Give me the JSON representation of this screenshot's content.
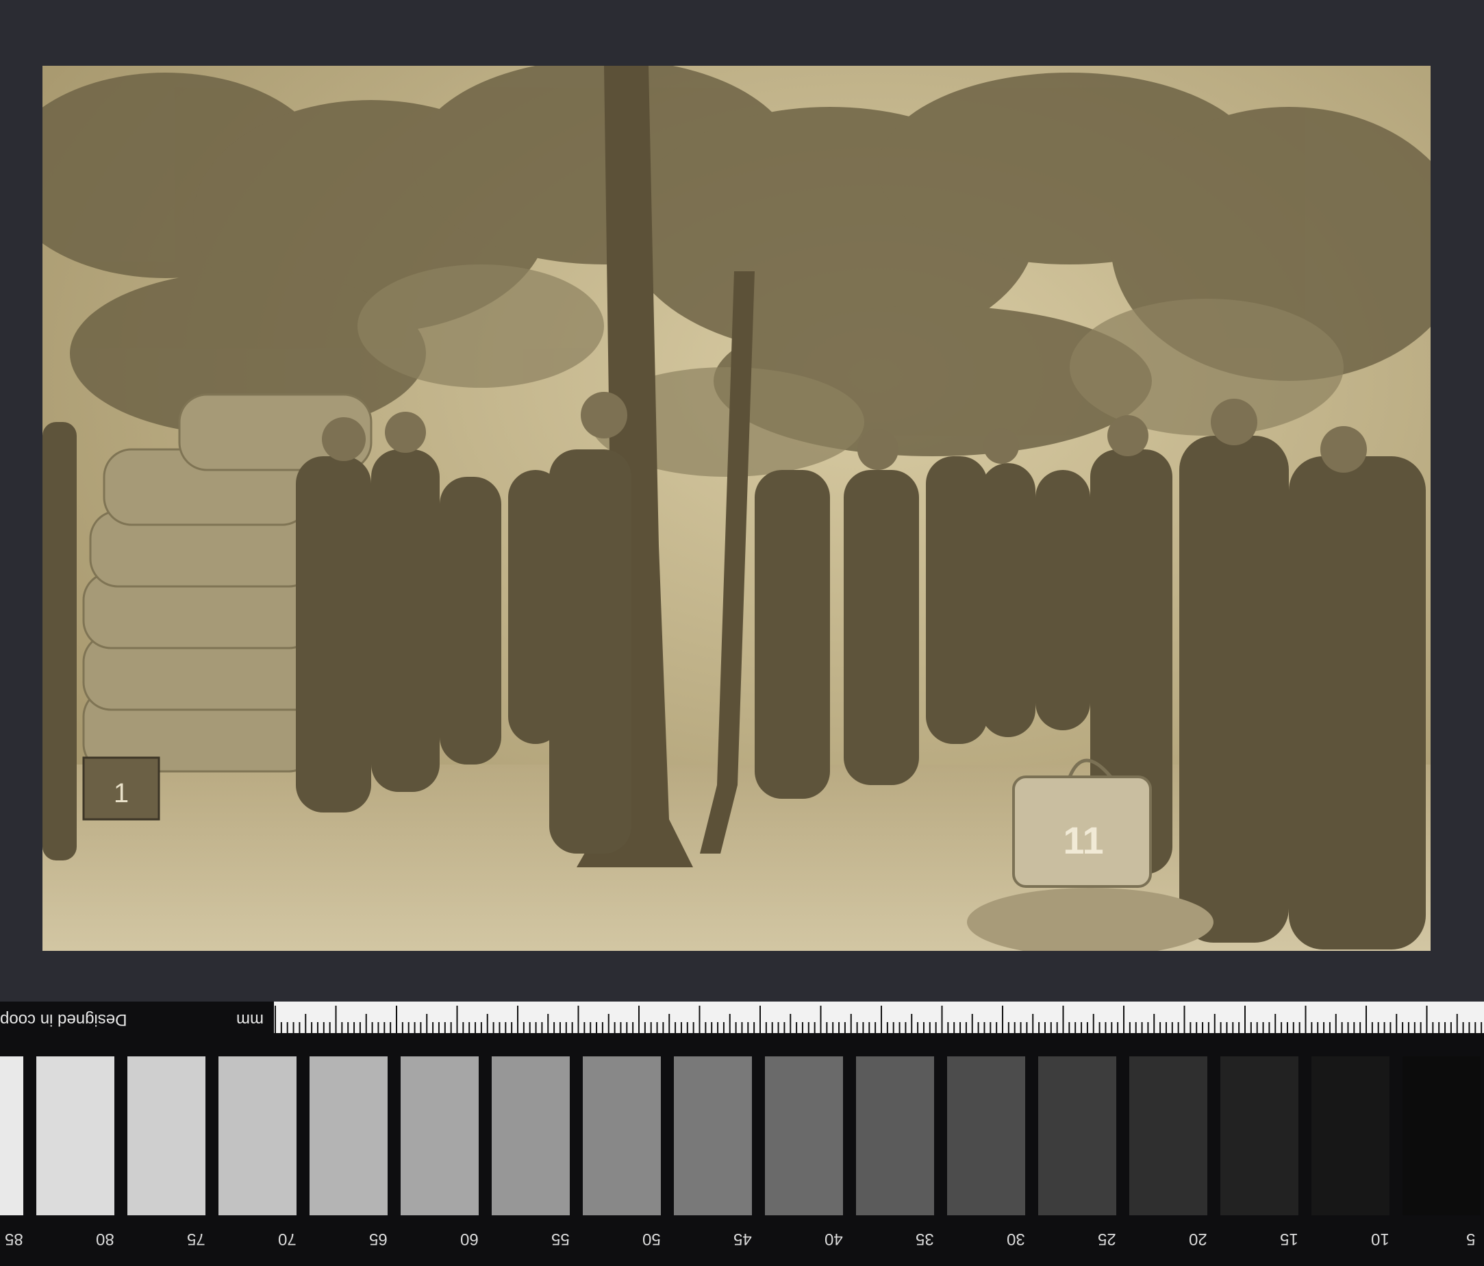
{
  "photo": {
    "bag_mark_left": "1",
    "bag_mark_right": "11"
  },
  "scale": {
    "credit": "Designed in coop",
    "unit": "mm",
    "numbers": [
      "85",
      "80",
      "75",
      "70",
      "65",
      "60",
      "55",
      "50",
      "45",
      "40",
      "35",
      "30",
      "25",
      "20",
      "15",
      "10",
      "5"
    ]
  },
  "colors": {
    "background": "#2b2c33",
    "photo_sepia": "#c9bc98",
    "patches": [
      "#e9e9e9",
      "#dcdcdc",
      "#cfcfcf",
      "#c2c2c2",
      "#b4b4b4",
      "#a6a6a6",
      "#979797",
      "#888888",
      "#797979",
      "#6a6a6a",
      "#5b5b5b",
      "#4c4c4c",
      "#3d3d3d",
      "#2f2f2f",
      "#222222",
      "#171717",
      "#0c0c0c"
    ]
  }
}
